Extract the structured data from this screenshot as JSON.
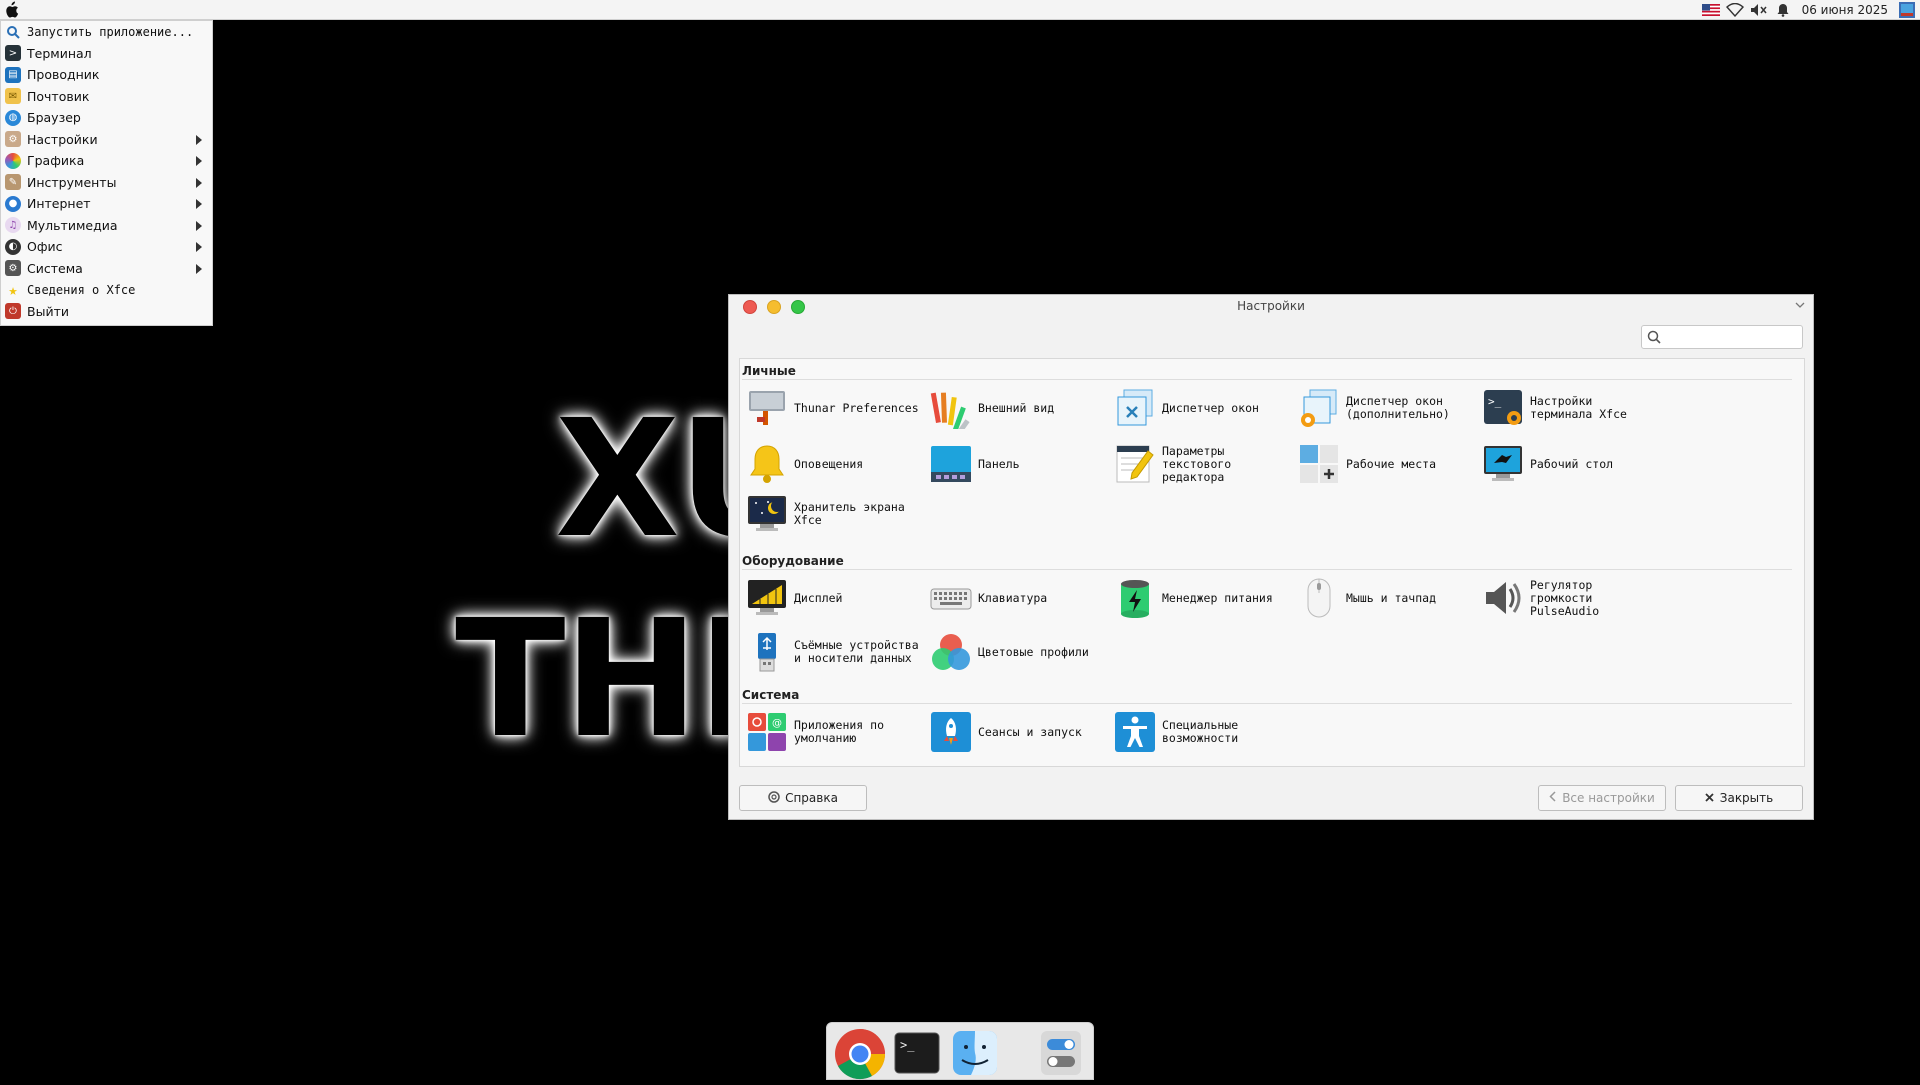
{
  "top_panel": {
    "clock": "06 июня 2025",
    "tray_icons": [
      "us-flag-icon",
      "wifi-icon",
      "speaker-muted-icon",
      "bell-icon",
      "user-icon"
    ]
  },
  "app_menu": {
    "items": [
      {
        "label": "Запустить приложение...",
        "icon": "search-icon",
        "submenu": false
      },
      {
        "label": "Терминал",
        "icon": "terminal-icon",
        "submenu": false
      },
      {
        "label": "Проводник",
        "icon": "file-manager-icon",
        "submenu": false
      },
      {
        "label": "Почтовик",
        "icon": "mail-icon",
        "submenu": false
      },
      {
        "label": "Браузер",
        "icon": "browser-icon",
        "submenu": false
      },
      {
        "label": "Настройки",
        "icon": "settings-icon",
        "submenu": true
      },
      {
        "label": "Графика",
        "icon": "graphics-icon",
        "submenu": true
      },
      {
        "label": "Инструменты",
        "icon": "tools-icon",
        "submenu": true
      },
      {
        "label": "Интернет",
        "icon": "internet-icon",
        "submenu": true
      },
      {
        "label": "Мультимедиа",
        "icon": "multimedia-icon",
        "submenu": true
      },
      {
        "label": "Офис",
        "icon": "office-icon",
        "submenu": true
      },
      {
        "label": "Система",
        "icon": "system-icon",
        "submenu": true
      },
      {
        "label": "Сведения о Xfce",
        "icon": "star-icon",
        "submenu": false
      },
      {
        "label": "Выйти",
        "icon": "logout-icon",
        "submenu": false
      }
    ]
  },
  "wallpaper": {
    "line1": "XU",
    "line2": "THE"
  },
  "settings_window": {
    "title": "Настройки",
    "search_placeholder": "",
    "sections": {
      "personal": {
        "title": "Личные",
        "items": [
          {
            "label": "Thunar Preferences",
            "icon": "thunar-preferences-icon"
          },
          {
            "label": "Внешний вид",
            "icon": "appearance-icon"
          },
          {
            "label": "Диспетчер окон",
            "icon": "window-manager-icon"
          },
          {
            "label": "Диспетчер окон\n(дополнительно)",
            "icon": "window-manager-tweaks-icon"
          },
          {
            "label": "Настройки\nтерминала Xfce",
            "icon": "terminal-settings-icon"
          },
          {
            "label": "Оповещения",
            "icon": "notifications-icon"
          },
          {
            "label": "Панель",
            "icon": "panel-icon"
          },
          {
            "label": "Параметры\nтекстового\nредактора",
            "icon": "text-editor-icon"
          },
          {
            "label": "Рабочие места",
            "icon": "workspaces-icon"
          },
          {
            "label": "Рабочий стол",
            "icon": "desktop-icon"
          },
          {
            "label": "Хранитель экрана\nXfce",
            "icon": "screensaver-icon"
          }
        ]
      },
      "hardware": {
        "title": "Оборудование",
        "items": [
          {
            "label": "Дисплей",
            "icon": "display-icon"
          },
          {
            "label": "Клавиатура",
            "icon": "keyboard-icon"
          },
          {
            "label": "Менеджер питания",
            "icon": "power-manager-icon"
          },
          {
            "label": "Мышь и тачпад",
            "icon": "mouse-icon"
          },
          {
            "label": "Регулятор\nгромкости\nPulseAudio",
            "icon": "volume-control-icon"
          },
          {
            "label": "Съёмные устройства\nи носители данных",
            "icon": "removable-drives-icon"
          },
          {
            "label": "Цветовые профили",
            "icon": "color-profiles-icon"
          }
        ]
      },
      "system": {
        "title": "Система",
        "items": [
          {
            "label": "Приложения по\nумолчанию",
            "icon": "default-apps-icon"
          },
          {
            "label": "Сеансы и запуск",
            "icon": "sessions-icon"
          },
          {
            "label": "Специальные\nвозможности",
            "icon": "accessibility-icon"
          }
        ]
      }
    },
    "buttons": {
      "help": "Справка",
      "all_settings": "Все настройки",
      "close": "Закрыть"
    }
  },
  "dock": {
    "items": [
      "chrome-icon",
      "terminal-icon",
      "finder-icon",
      "settings-toggle-icon"
    ]
  }
}
